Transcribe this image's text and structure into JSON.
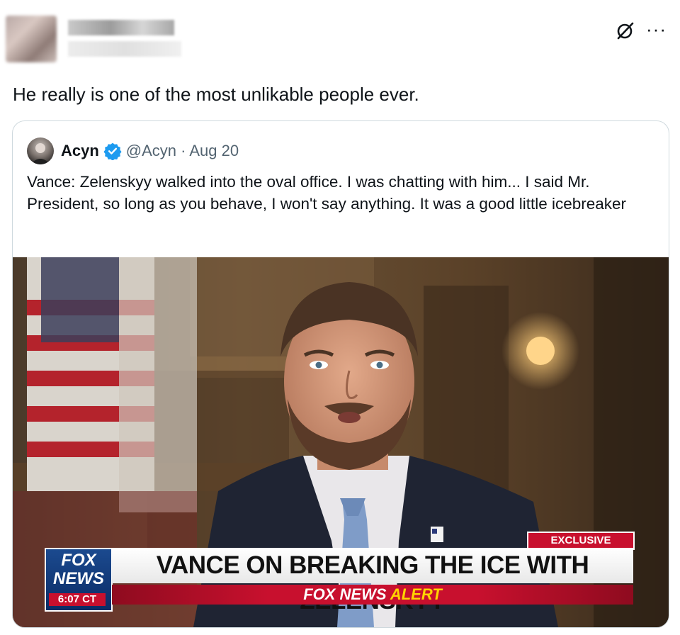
{
  "post": {
    "text": "He really is one of the most unlikable people ever.",
    "icons": {
      "grok": "grok-icon",
      "more": "more-options-icon"
    },
    "more_label": "···"
  },
  "quote": {
    "name": "Acyn",
    "handle_date": "@Acyn · Aug 20",
    "text": "Vance: Zelenskyy walked into the oval office. I was chatting with him... I said Mr. President, so long as you behave, I won't say anything. It was a good little icebreaker",
    "verified_color": "#1d9bf0",
    "media": {
      "exclusive_label": "EXCLUSIVE",
      "logo_fox": "FOX",
      "logo_news": "NEWS",
      "time": "6:07 CT",
      "headline": "VANCE ON BREAKING THE ICE WITH ZELENSKYY",
      "alert_prefix": "FOX NEWS",
      "alert_word": "ALERT"
    }
  }
}
